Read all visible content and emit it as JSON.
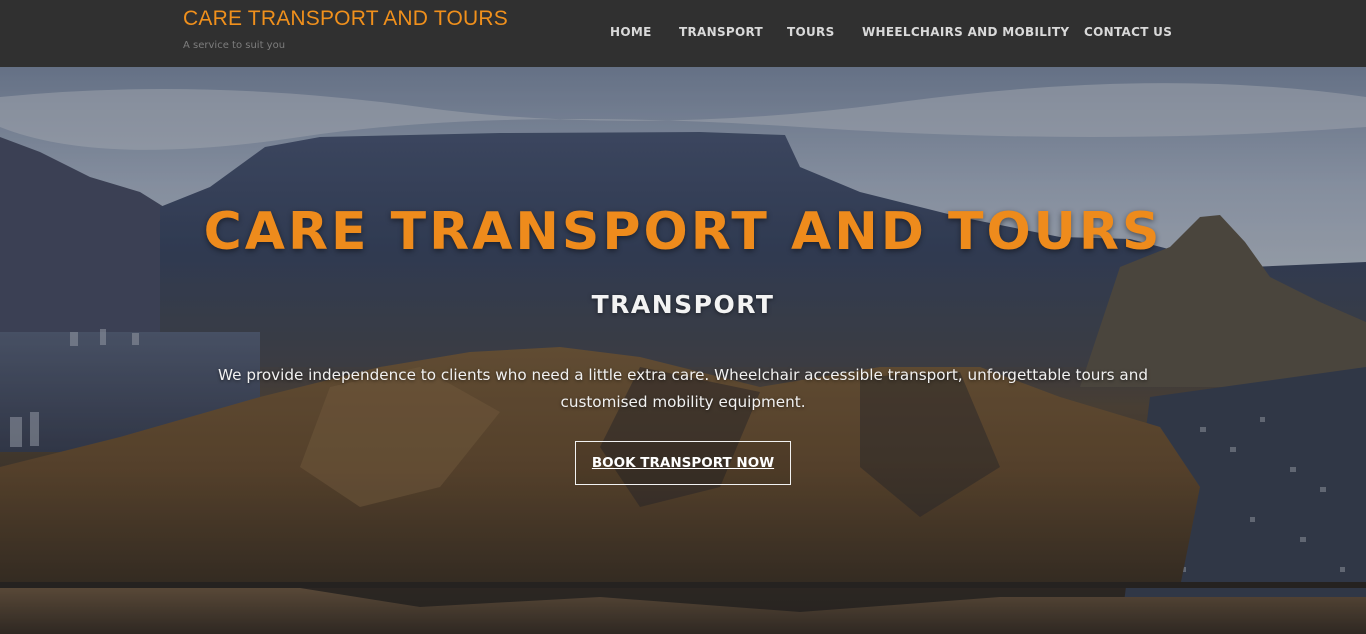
{
  "header": {
    "brand_title": "CARE TRANSPORT AND TOURS",
    "tagline": "A service to suit you",
    "nav": [
      "HOME",
      "TRANSPORT",
      "TOURS",
      "WHEELCHAIRS AND MOBILITY",
      "CONTACT US"
    ]
  },
  "hero": {
    "title": "CARE TRANSPORT AND TOURS",
    "subtitle": "TRANSPORT",
    "text": "We provide independence to clients who need a little extra care. Wheelchair accessible transport, unforgettable tours and customised mobility equipment.",
    "button_label": "BOOK TRANSPORT NOW"
  },
  "colors": {
    "header_bg": "#303030",
    "brand_accent": "#f0901c",
    "hero_title": "#ee8b1c",
    "nav_text": "#d9d9d9"
  }
}
